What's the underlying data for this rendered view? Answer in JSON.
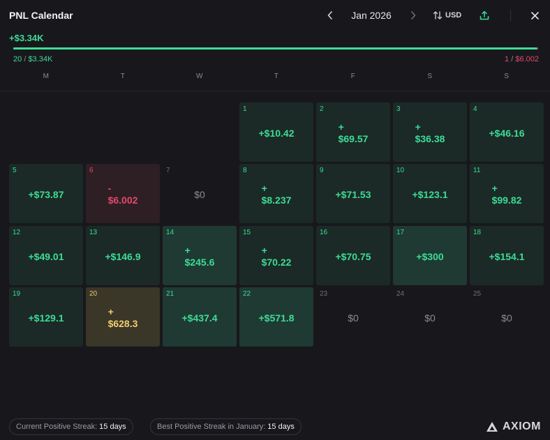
{
  "header": {
    "title": "PNL Calendar",
    "month": "Jan 2026",
    "currency": "USD"
  },
  "summary": {
    "total": "+$3.34K",
    "positive_days": "20",
    "positive_total": "$3.34K",
    "negative_days": "1",
    "negative_total": "$6.002",
    "slash": "/",
    "positive_fraction": 0.998
  },
  "weekdays": [
    "M",
    "T",
    "W",
    "T",
    "F",
    "S",
    "S"
  ],
  "days": [
    {
      "day": "1",
      "amount": "+$10.42",
      "state": "pos",
      "wrap": false
    },
    {
      "day": "2",
      "amount": "$69.57",
      "sign": "+",
      "state": "pos",
      "wrap": true
    },
    {
      "day": "3",
      "amount": "$36.38",
      "sign": "+",
      "state": "pos",
      "wrap": true
    },
    {
      "day": "4",
      "amount": "+$46.16",
      "state": "pos",
      "wrap": false
    },
    {
      "day": "5",
      "amount": "+$73.87",
      "state": "pos",
      "wrap": false
    },
    {
      "day": "6",
      "amount": "$6.002",
      "sign": "-",
      "state": "neg",
      "wrap": true
    },
    {
      "day": "7",
      "amount": "$0",
      "state": "zero",
      "wrap": false
    },
    {
      "day": "8",
      "amount": "$8.237",
      "sign": "+",
      "state": "pos",
      "wrap": true
    },
    {
      "day": "9",
      "amount": "+$71.53",
      "state": "pos",
      "wrap": false
    },
    {
      "day": "10",
      "amount": "+$123.1",
      "state": "pos",
      "wrap": false
    },
    {
      "day": "11",
      "amount": "$99.82",
      "sign": "+",
      "state": "pos",
      "wrap": true
    },
    {
      "day": "12",
      "amount": "+$49.01",
      "state": "pos",
      "wrap": false
    },
    {
      "day": "13",
      "amount": "+$146.9",
      "state": "pos",
      "wrap": false
    },
    {
      "day": "14",
      "amount": "$245.6",
      "sign": "+",
      "state": "pos hi",
      "wrap": true
    },
    {
      "day": "15",
      "amount": "$70.22",
      "sign": "+",
      "state": "pos",
      "wrap": true
    },
    {
      "day": "16",
      "amount": "+$70.75",
      "state": "pos",
      "wrap": false
    },
    {
      "day": "17",
      "amount": "+$300",
      "state": "pos hi",
      "wrap": false
    },
    {
      "day": "18",
      "amount": "+$154.1",
      "state": "pos",
      "wrap": false
    },
    {
      "day": "19",
      "amount": "+$129.1",
      "state": "pos",
      "wrap": false
    },
    {
      "day": "20",
      "amount": "$628.3",
      "sign": "+",
      "state": "best",
      "wrap": true
    },
    {
      "day": "21",
      "amount": "+$437.4",
      "state": "pos hi",
      "wrap": false
    },
    {
      "day": "22",
      "amount": "+$571.8",
      "state": "pos hi",
      "wrap": false
    },
    {
      "day": "23",
      "amount": "$0",
      "state": "zero",
      "wrap": false
    },
    {
      "day": "24",
      "amount": "$0",
      "state": "zero",
      "wrap": false
    },
    {
      "day": "25",
      "amount": "$0",
      "state": "zero",
      "wrap": false
    }
  ],
  "footer": {
    "current_streak_label": "Current Positive Streak:",
    "current_streak_value": "15 days",
    "best_streak_label": "Best Positive Streak in January:",
    "best_streak_value": "15 days",
    "logo": "AXIOM"
  },
  "colors": {
    "positive": "#3ddc97",
    "negative": "#e5486b",
    "best": "#f0cf6e",
    "background": "#18181c"
  },
  "icons": {
    "prev": "chevron-left-icon",
    "next": "chevron-right-icon",
    "currency": "swap-vertical-icon",
    "share": "share-upload-icon",
    "close": "close-icon",
    "logo": "axiom-logo-icon"
  }
}
